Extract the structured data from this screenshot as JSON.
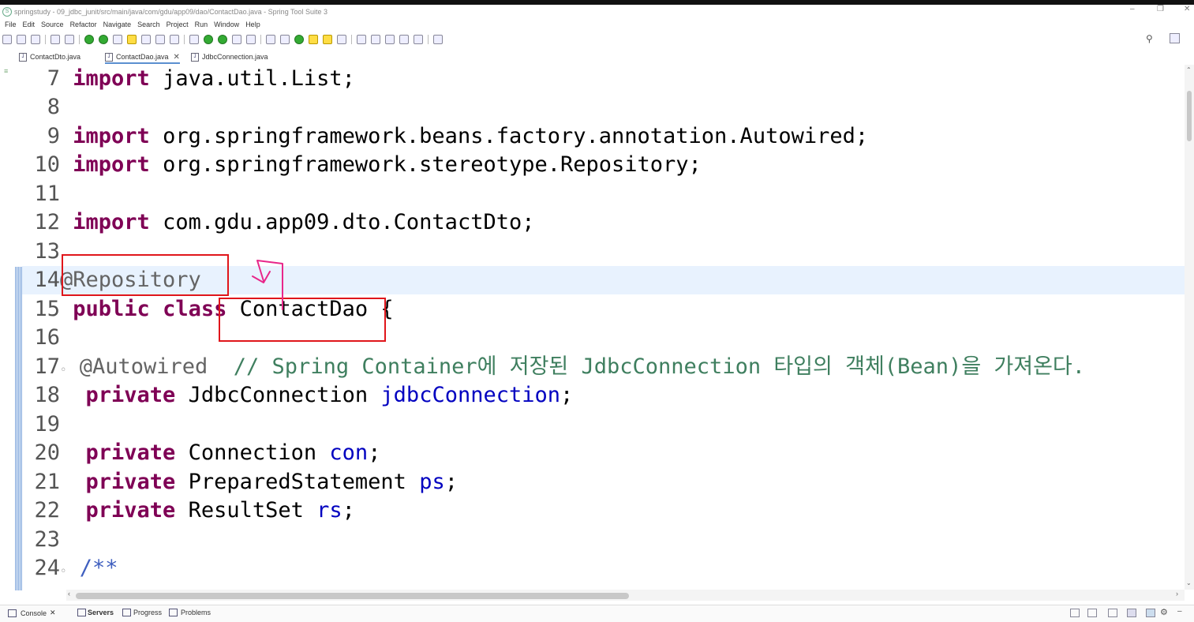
{
  "window": {
    "title": "springstudy - 09_jdbc_junit/src/main/java/com/gdu/app09/dao/ContactDao.java - Spring Tool Suite 3",
    "minimize": "–",
    "restore": "❐",
    "close": "✕"
  },
  "menu": [
    "File",
    "Edit",
    "Source",
    "Refactor",
    "Navigate",
    "Search",
    "Project",
    "Run",
    "Window",
    "Help"
  ],
  "tabs": [
    {
      "label": "ContactDto.java"
    },
    {
      "label": "ContactDao.java"
    },
    {
      "label": "JdbcConnection.java"
    }
  ],
  "active_tab_close": "✕",
  "code_lines": [
    {
      "n": "7"
    },
    {
      "n": "8"
    },
    {
      "n": "9"
    },
    {
      "n": "10"
    },
    {
      "n": "11"
    },
    {
      "n": "12"
    },
    {
      "n": "13"
    },
    {
      "n": "14"
    },
    {
      "n": "15"
    },
    {
      "n": "16"
    },
    {
      "n": "17"
    },
    {
      "n": "18"
    },
    {
      "n": "19"
    },
    {
      "n": "20"
    },
    {
      "n": "21"
    },
    {
      "n": "22"
    },
    {
      "n": "23"
    },
    {
      "n": "24"
    }
  ],
  "code": {
    "kw_import": "import",
    "kw_public": "public",
    "kw_class": "class",
    "kw_private": "private",
    "l7": " java.util.List;",
    "l9": " org.springframework.beans.factory.annotation.Autowired;",
    "l10": " org.springframework.stereotype.Repository;",
    "l12": " com.gdu.app09.dto.ContactDto;",
    "l14_ann": "@Repository",
    "l15_name": "ContactDao {",
    "l17_ann": "@Autowired",
    "l17_cmt": "// Spring Container에 저장된 JdbcConnection 타입의 객체(Bean)을 가져온다.",
    "l18_type": "JdbcConnection",
    "l18_field": "jdbcConnection",
    "l20_type": "Connection",
    "l20_field": "con",
    "l21_type": "PreparedStatement",
    "l21_field": "ps",
    "l22_type": "ResultSet",
    "l22_field": "rs",
    "semicolon": ";",
    "l24_doc": "/**",
    "fold_marker": "◦"
  },
  "bottom_tabs": [
    {
      "label": "Console"
    },
    {
      "label": "Servers"
    },
    {
      "label": "Progress"
    },
    {
      "label": "Problems"
    }
  ],
  "bottom_close": "✕",
  "colors": {
    "keyword": "#7f0055",
    "annotation": "#646464",
    "field": "#0000c0",
    "comment": "#3f7f5f",
    "highlight_box": "#e0161b",
    "hand_drawn_arrow": "#e8278a",
    "current_line": "#e8f2fe"
  }
}
